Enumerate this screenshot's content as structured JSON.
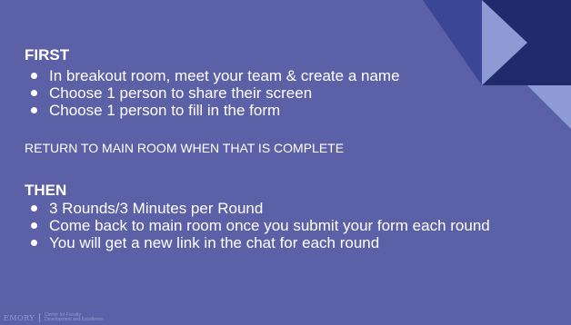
{
  "slide": {
    "first_heading": "FIRST",
    "first_items": [
      "In breakout room, meet your team & create a name",
      "Choose 1 person to share their screen",
      "Choose 1 person to fill in the form"
    ],
    "return_note": "RETURN TO MAIN ROOM WHEN THAT IS COMPLETE",
    "then_heading": "THEN",
    "then_items": [
      "3 Rounds/3 Minutes per Round",
      "Come back to main room once you submit your form each round",
      "You will get a new link in the chat for each round"
    ]
  },
  "footer": {
    "logo_mark": "EMORY",
    "logo_line1": "Center for Faculty",
    "logo_line2": "Development and Excellence"
  },
  "colors": {
    "background": "#5c60a6",
    "deco_light": "#8e9ad3",
    "deco_mid": "#3c4696",
    "deco_dark": "#222a6e",
    "text": "#ffffff"
  }
}
